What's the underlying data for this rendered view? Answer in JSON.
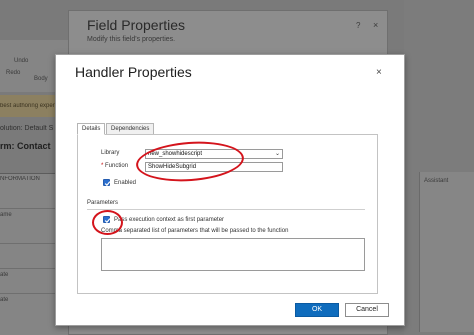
{
  "background": {
    "toolbar": {
      "undo_label": "Undo",
      "redo_label": "Redo",
      "body_label": "Body"
    },
    "authoring_banner": "best authoring experie",
    "solution_label": "olution: Default S",
    "form_label": "rm: Contact",
    "panel_header": "NFORMATION",
    "rows": [
      "ame",
      "",
      "ate",
      "ate"
    ],
    "right_panel_header": "Assistant"
  },
  "field_properties": {
    "title": "Field Properties",
    "subtitle": "Modify this field's properties.",
    "help_icon": "?",
    "close_icon": "×"
  },
  "handler_properties": {
    "title": "Handler Properties",
    "close_icon": "×",
    "tabs": [
      {
        "label": "Details",
        "active": true
      },
      {
        "label": "Dependencies",
        "active": false
      }
    ],
    "library_label": "Library",
    "library_value": "new_showhidescript",
    "function_required_marker": "*",
    "function_label": "Function",
    "function_value": "ShowHideSubgrid",
    "enabled_label": "Enabled",
    "enabled_checked": true,
    "parameters_section": "Parameters",
    "pass_context_label": "Pass execution context as first parameter",
    "pass_context_checked": true,
    "params_hint": "Comma separated list of parameters that will be passed to the function",
    "params_value": "",
    "ok_label": "OK",
    "cancel_label": "Cancel"
  },
  "colors": {
    "accent": "#0f6cbd",
    "checkbox": "#2b6fce",
    "annotation": "#d4141c",
    "overlay": "#7a7a7a"
  }
}
